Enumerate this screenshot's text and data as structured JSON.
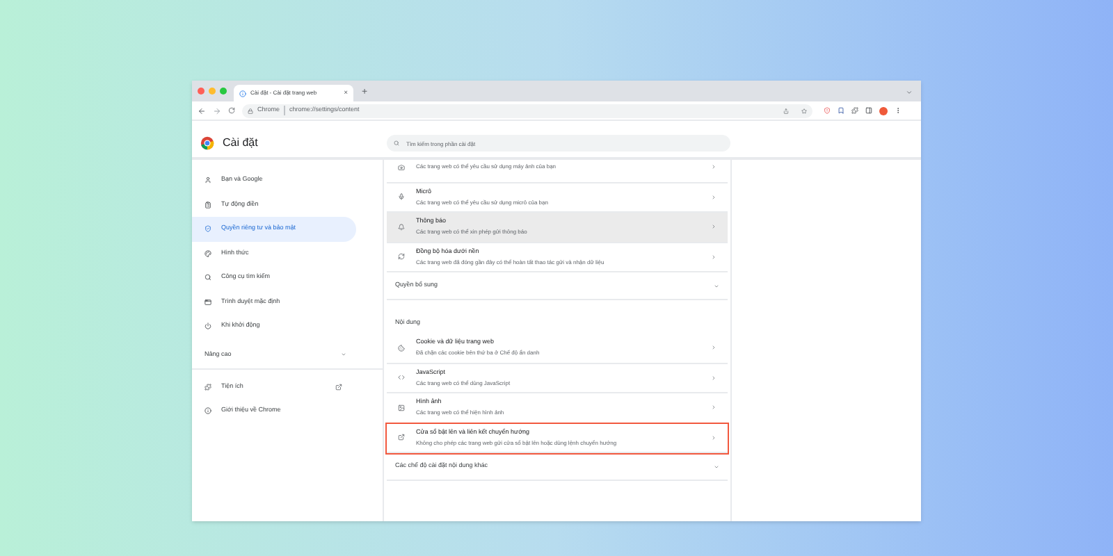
{
  "browser": {
    "tab": {
      "title": "Cài đặt - Cài đặt trang web",
      "close": "×"
    },
    "new_tab": "+",
    "address": {
      "site": "Chrome",
      "url": "chrome://settings/content"
    }
  },
  "header": {
    "title": "Cài đặt",
    "search": {
      "placeholder": "Tìm kiếm trong phần cài đặt"
    }
  },
  "sidebar": {
    "items": [
      {
        "kind": "item",
        "label": "Bạn và Google",
        "selected": false
      },
      {
        "kind": "item",
        "label": "Tự động điền",
        "selected": false
      },
      {
        "kind": "item",
        "label": "Quyền riêng tư và bảo mật",
        "selected": true
      },
      {
        "kind": "item",
        "label": "Hình thức",
        "selected": false
      },
      {
        "kind": "item",
        "label": "Công cụ tìm kiếm",
        "selected": false
      },
      {
        "kind": "item",
        "label": "Trình duyệt mặc định",
        "selected": false
      },
      {
        "kind": "item",
        "label": "Khi khởi động",
        "selected": false
      },
      {
        "kind": "group",
        "label": "Nâng cao",
        "expanded": false
      },
      {
        "kind": "link",
        "label": "Tiện ích",
        "selected": false
      },
      {
        "kind": "item",
        "label": "Giới thiệu về Chrome",
        "selected": false
      }
    ]
  },
  "main": {
    "items": [
      {
        "kind": "row",
        "subtitle": "Các trang web có thể yêu cầu sử dụng máy ảnh của bạn",
        "selected": false,
        "outlined": false
      },
      {
        "kind": "row",
        "title": "Micrô",
        "subtitle": "Các trang web có thể yêu cầu sử dụng micrô của bạn",
        "selected": false,
        "outlined": false
      },
      {
        "kind": "row",
        "title": "Thông báo",
        "subtitle": "Các trang web có thể xin phép gửi thông báo",
        "selected": true,
        "outlined": false
      },
      {
        "kind": "row",
        "title": "Đồng bộ hóa dưới nền",
        "subtitle": "Các trang web đã đóng gần đây có thể hoàn tất thao tác gửi và nhận dữ liệu",
        "selected": false,
        "outlined": false
      },
      {
        "kind": "expander",
        "label": "Quyền bổ sung",
        "expanded": false
      },
      {
        "kind": "heading",
        "label": "Nội dung"
      },
      {
        "kind": "row",
        "title": "Cookie và dữ liệu trang web",
        "subtitle": "Đã chặn các cookie bên thứ ba ở Chế độ ẩn danh",
        "selected": false,
        "outlined": false
      },
      {
        "kind": "row",
        "title": "JavaScript",
        "subtitle": "Các trang web có thể dùng JavaScript",
        "selected": false,
        "outlined": false
      },
      {
        "kind": "row",
        "title": "Hình ảnh",
        "subtitle": "Các trang web có thể hiện hình ảnh",
        "selected": false,
        "outlined": false
      },
      {
        "kind": "row",
        "title": "Cửa sổ bật lên và liên kết chuyển hướng",
        "subtitle": "Không cho phép các trang web gửi cửa sổ bật lên hoặc dùng lệnh chuyển hướng",
        "selected": false,
        "outlined": true
      },
      {
        "kind": "expander",
        "label": "Các chế độ cài đặt nội dung khác",
        "expanded": false
      }
    ]
  }
}
